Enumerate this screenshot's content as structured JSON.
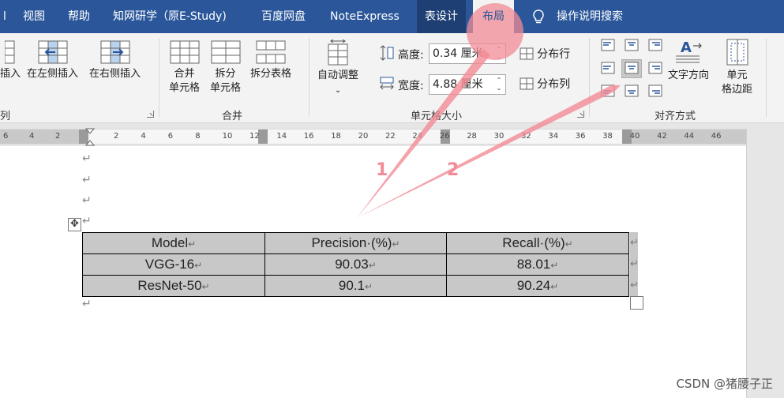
{
  "tabs": {
    "partial_first": "l",
    "view": "视图",
    "help": "帮助",
    "cnki": "知网研学（原E-Study)",
    "baidu": "百度网盘",
    "noteexpress": "NoteExpress",
    "table_design": "表设计",
    "layout": "布局",
    "tell_me": "操作说明搜索"
  },
  "ribbon": {
    "rows_cols": {
      "insert_below": "插入",
      "insert_left": "在左侧插入",
      "insert_right": "在右侧插入",
      "group_label_partial": "列"
    },
    "merge": {
      "merge_cells_line1": "合并",
      "merge_cells_line2": "单元格",
      "split_cells_line1": "拆分",
      "split_cells_line2": "单元格",
      "split_table": "拆分表格",
      "group_label": "合并"
    },
    "cell_size": {
      "autofit": "自动调整",
      "height_label": "高度:",
      "height_value": "0.34 厘米",
      "width_label": "宽度:",
      "width_value": "4.88 厘米",
      "distribute_rows": "分布行",
      "distribute_cols": "分布列",
      "group_label": "单元格大小"
    },
    "alignment": {
      "text_direction": "文字方向",
      "cell_margins_line1": "单元",
      "cell_margins_line2": "格边距",
      "group_label": "对齐方式"
    }
  },
  "ruler": {
    "left_ticks": [
      "6",
      "4",
      "2"
    ],
    "right_ticks": [
      "2",
      "4",
      "6",
      "8",
      "10",
      "12",
      "14",
      "16",
      "18",
      "20",
      "22",
      "24",
      "26",
      "28",
      "30",
      "32",
      "34",
      "36",
      "38",
      "40",
      "42",
      "44",
      "46"
    ]
  },
  "document": {
    "paragraph_mark": "↵",
    "table": {
      "headers": [
        "Model",
        "Precision·(%)",
        "Recall·(%)"
      ],
      "rows": [
        [
          "VGG-16",
          "90.03",
          "88.01"
        ],
        [
          "ResNet-50",
          "90.1",
          "90.24"
        ]
      ]
    }
  },
  "annotations": {
    "label_1": "1",
    "label_2": "2"
  },
  "watermark": "CSDN @猪腰子正",
  "colors": {
    "tabbar": "#2b579a",
    "annotation": "#f28b96"
  }
}
